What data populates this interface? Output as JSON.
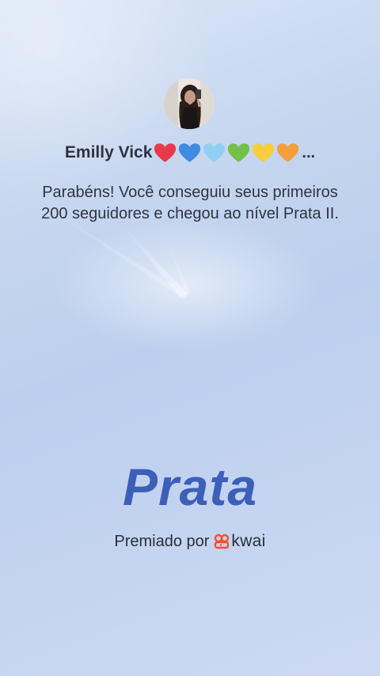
{
  "user": {
    "name": "Emilly Vick",
    "hearts": [
      {
        "icon": "red-heart-icon",
        "color": "#e83a4a"
      },
      {
        "icon": "blue-heart-icon",
        "color": "#3f8be0"
      },
      {
        "icon": "light-blue-heart-icon",
        "color": "#8fd0f2"
      },
      {
        "icon": "green-heart-icon",
        "color": "#74c04a"
      },
      {
        "icon": "yellow-heart-icon",
        "color": "#f6cf3a"
      },
      {
        "icon": "orange-heart-icon",
        "color": "#f3a03c"
      }
    ],
    "truncation": "..."
  },
  "message": "Parabéns! Você conseguiu seus primeiros 200 seguidores e chegou ao nível Prata II.",
  "level": {
    "title": "Prata",
    "color": "#3d5fb8"
  },
  "footer": {
    "awarded_by": "Premiado por",
    "brand": "kwai",
    "brand_icon": "kwai-logo-icon",
    "brand_color": "#ff4b2b"
  }
}
